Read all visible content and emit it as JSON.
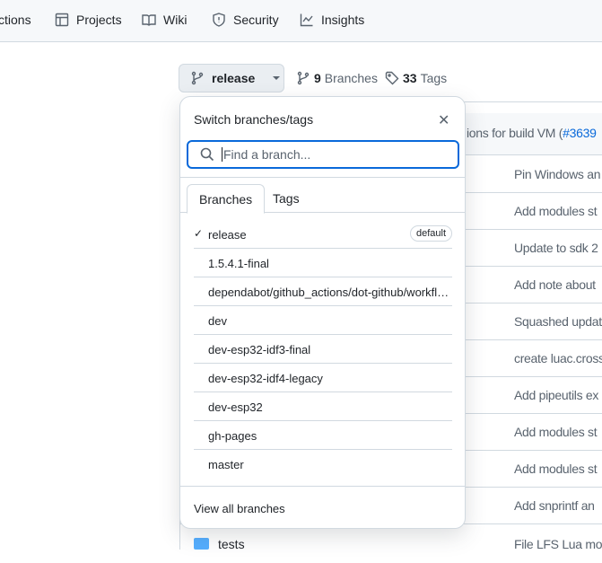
{
  "nav": {
    "items": [
      {
        "label": "ctions",
        "icon": "play-icon"
      },
      {
        "label": "Projects",
        "icon": "table-icon"
      },
      {
        "label": "Wiki",
        "icon": "book-icon"
      },
      {
        "label": "Security",
        "icon": "shield-icon"
      },
      {
        "label": "Insights",
        "icon": "graph-icon"
      }
    ]
  },
  "branch_button": {
    "label": "release"
  },
  "meta": {
    "branches_count": "9",
    "branches_label": "Branches",
    "tags_count": "33",
    "tags_label": "Tags"
  },
  "file_list": {
    "header_text": "ions for build VM (",
    "header_link": "#3639",
    "rows": [
      "Pin Windows an",
      "Add modules st",
      "Update to sdk 2",
      "Add note about",
      "Squashed updat",
      "create luac.cross",
      "Add pipeutils ex",
      "Add modules st",
      "Add modules st",
      "Add snprintf an"
    ],
    "last_row": {
      "name": "tests",
      "msg": "File LFS Lua moc"
    }
  },
  "dropdown": {
    "title": "Switch branches/tags",
    "search_placeholder": "Find a branch...",
    "tabs": [
      "Branches",
      "Tags"
    ],
    "branches": [
      {
        "label": "release",
        "selected": true,
        "badge": "default"
      },
      {
        "label": "1.5.4.1-final"
      },
      {
        "label": "dependabot/github_actions/dot-github/workflows/..."
      },
      {
        "label": "dev"
      },
      {
        "label": "dev-esp32-idf3-final"
      },
      {
        "label": "dev-esp32-idf4-legacy"
      },
      {
        "label": "dev-esp32"
      },
      {
        "label": "gh-pages"
      },
      {
        "label": "master"
      }
    ],
    "footer": "View all branches"
  },
  "colors": {
    "accent": "#0969da",
    "folder": "#54aeff",
    "nav_bg": "#f6f8fa"
  }
}
